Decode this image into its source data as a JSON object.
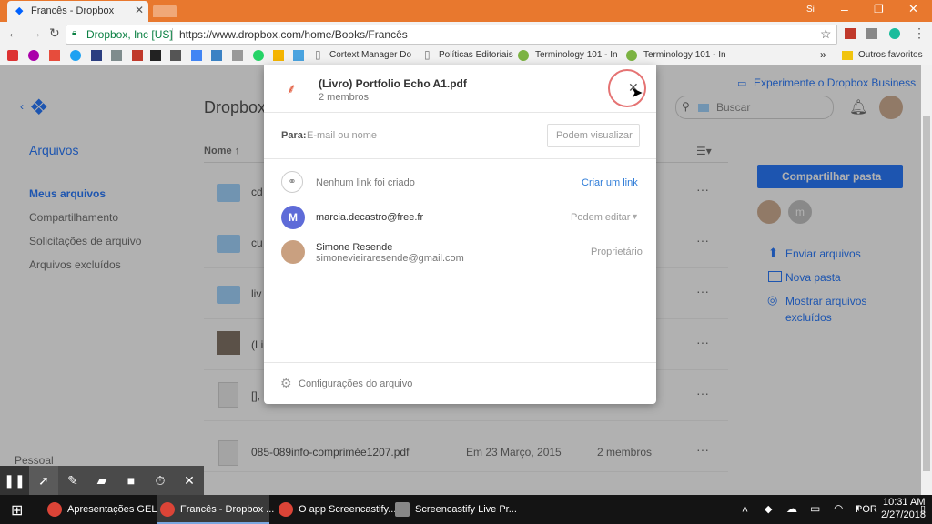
{
  "browser": {
    "tab_title": "Francês - Dropbox",
    "window_user": "Si",
    "site_identity": "Dropbox, Inc [US]",
    "url": "https://www.dropbox.com/home/Books/Francês",
    "bookmarks": [
      "Cortext Manager Do",
      "Políticas Editoriais",
      "Terminology 101 - In",
      "Terminology 101 - In"
    ],
    "bookmarks_more": "»",
    "other_bookmarks": "Outros favoritos"
  },
  "page": {
    "business_link": "Experimente o Dropbox Business",
    "header_title": "Dropbox",
    "search_placeholder": "Buscar",
    "sidebar_title": "Arquivos",
    "sidebar_items": [
      "Meus arquivos",
      "Compartilhamento",
      "Solicitações de arquivo",
      "Arquivos excluídos"
    ],
    "sidebar_footer": "Pessoal",
    "column_name": "Nome ↑",
    "files": [
      {
        "name": "cd",
        "date": "",
        "members": ""
      },
      {
        "name": "cu",
        "date": "",
        "members": ""
      },
      {
        "name": "liv",
        "date": "",
        "members": ""
      },
      {
        "name": "(Li",
        "date": "",
        "members": ""
      },
      {
        "name": "[],",
        "date": "",
        "members": ""
      },
      {
        "name": "085-089info-comprimée1207.pdf",
        "date": "Em 23 Março, 2015",
        "members": "2 membros"
      }
    ],
    "share_folder_button": "Compartilhar pasta",
    "member_initial": "m",
    "actions": [
      "Enviar arquivos",
      "Nova pasta",
      "Mostrar arquivos",
      "excluídos"
    ]
  },
  "dialog": {
    "file_name": "(Livro) Portfolio Echo A1.pdf",
    "members_count": "2 membros",
    "to_label": "Para:",
    "to_placeholder": "E-mail ou nome",
    "permission_button": "Podem visualizar",
    "no_link_text": "Nenhum link foi criado",
    "create_link": "Criar um link",
    "members": [
      {
        "initial": "M",
        "name": "marcia.decastro@free.fr",
        "email": "",
        "role": "Podem editar"
      },
      {
        "initial": "",
        "name": "Simone Resende",
        "email": "simonevieiraresende@gmail.com",
        "role": "Proprietário"
      }
    ],
    "settings": "Configurações do arquivo"
  },
  "screencastify_toolbar": [
    "pause-icon",
    "cursor-icon",
    "pen-icon",
    "eraser-icon",
    "camera-icon",
    "timer-icon",
    "close-icon"
  ],
  "taskbar": {
    "tasks": [
      "Apresentações GEL...",
      "Francês - Dropbox ...",
      "O app Screencastify...",
      "Screencastify Live Pr..."
    ],
    "language": "POR",
    "time": "10:31 AM",
    "date": "2/27/2018"
  },
  "colors": {
    "brand_blue": "#0061fe",
    "link_blue": "#2e7cd8",
    "chrome_orange": "#e8782e",
    "avatar_purple": "#5e6bd8"
  }
}
